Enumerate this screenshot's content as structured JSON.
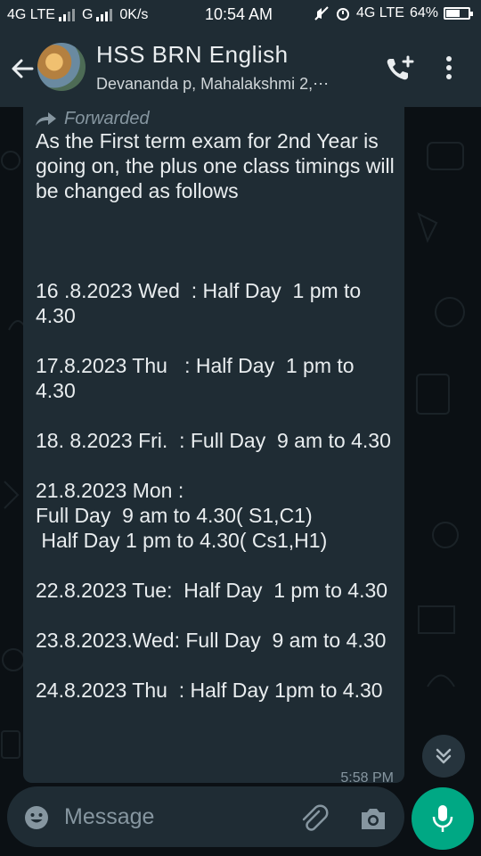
{
  "status_bar": {
    "left_text": "4G LTE",
    "network2": "G",
    "speed": "0K/s",
    "time": "10:54 AM",
    "right_network": "4G LTE",
    "battery": "64%",
    "battery_level": 0.64
  },
  "header": {
    "title": "HSS BRN English",
    "subtitle": "Devananda p, Mahalakshmi 2,⋯"
  },
  "message": {
    "forwarded_label": "Forwarded",
    "text": "As the First term exam for 2nd Year is going on, the plus one class timings will be changed as follows\n\n\n\n16 .8.2023 Wed  : Half Day  1 pm to 4.30\n\n17.8.2023 Thu   : Half Day  1 pm to 4.30\n\n18. 8.2023 Fri.  : Full Day  9 am to 4.30\n\n21.8.2023 Mon :\nFull Day  9 am to 4.30( S1,C1)\n Half Day 1 pm to 4.30( Cs1,H1)\n\n22.8.2023 Tue:  Half Day  1 pm to 4.30\n\n23.8.2023.Wed: Full Day  9 am to 4.30\n\n24.8.2023 Thu  : Half Day 1pm to 4.30",
    "time": "5:58 PM"
  },
  "composer": {
    "placeholder": "Message"
  },
  "icons": {
    "back": "arrow-left",
    "call": "phone-plus",
    "menu": "dots-vertical",
    "emoji": "smiley",
    "attach": "paperclip",
    "camera": "camera",
    "mic": "microphone",
    "scroll": "chevrons-down"
  },
  "colors": {
    "header_bg": "#1f2c34",
    "chat_bg": "#0b1014",
    "bubble_bg": "#1f2c34",
    "accent": "#00a884"
  }
}
